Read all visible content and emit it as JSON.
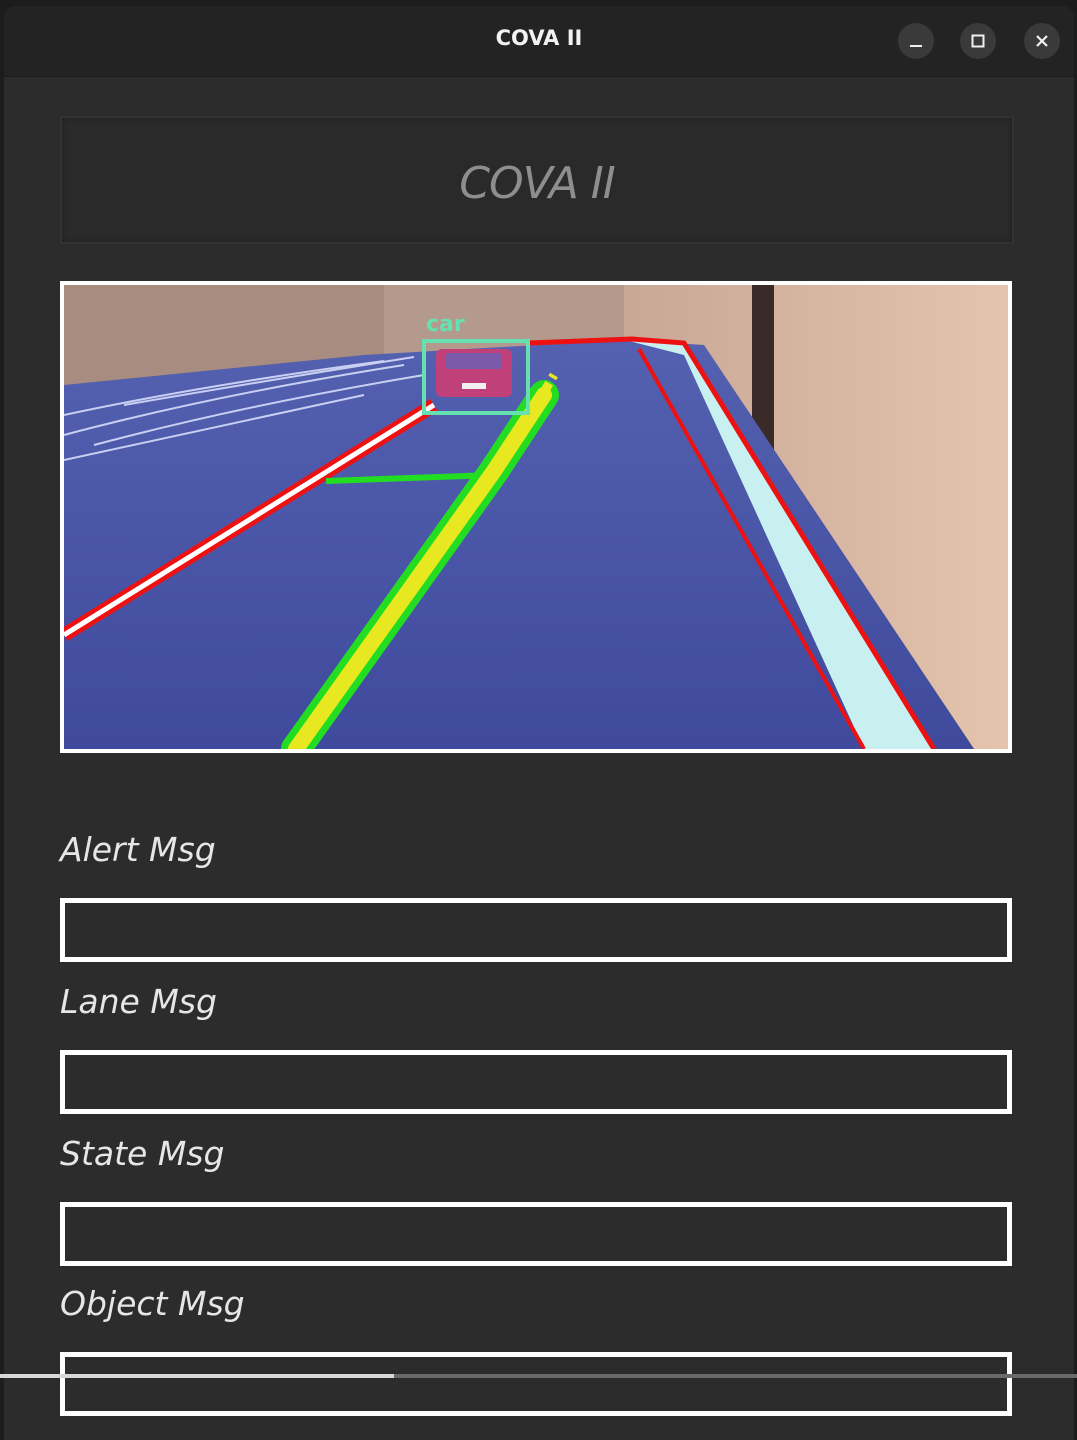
{
  "window": {
    "title": "COVA II",
    "controls": [
      "minimize-icon",
      "maximize-icon",
      "close-icon"
    ]
  },
  "header": {
    "title": "COVA II"
  },
  "camera": {
    "detection_label": "car",
    "colors": {
      "lane_boundary": "#ee1111",
      "lane_fill": "#c8f0f0",
      "center_line": "#e8e820",
      "center_line_outline": "#22dd22",
      "detection_box": "#66e0b0"
    }
  },
  "fields": [
    {
      "label": "Alert Msg",
      "value": ""
    },
    {
      "label": "Lane Msg",
      "value": ""
    },
    {
      "label": "State Msg",
      "value": ""
    },
    {
      "label": "Object Msg",
      "value": ""
    }
  ],
  "playback": {
    "progress": 0.366
  }
}
